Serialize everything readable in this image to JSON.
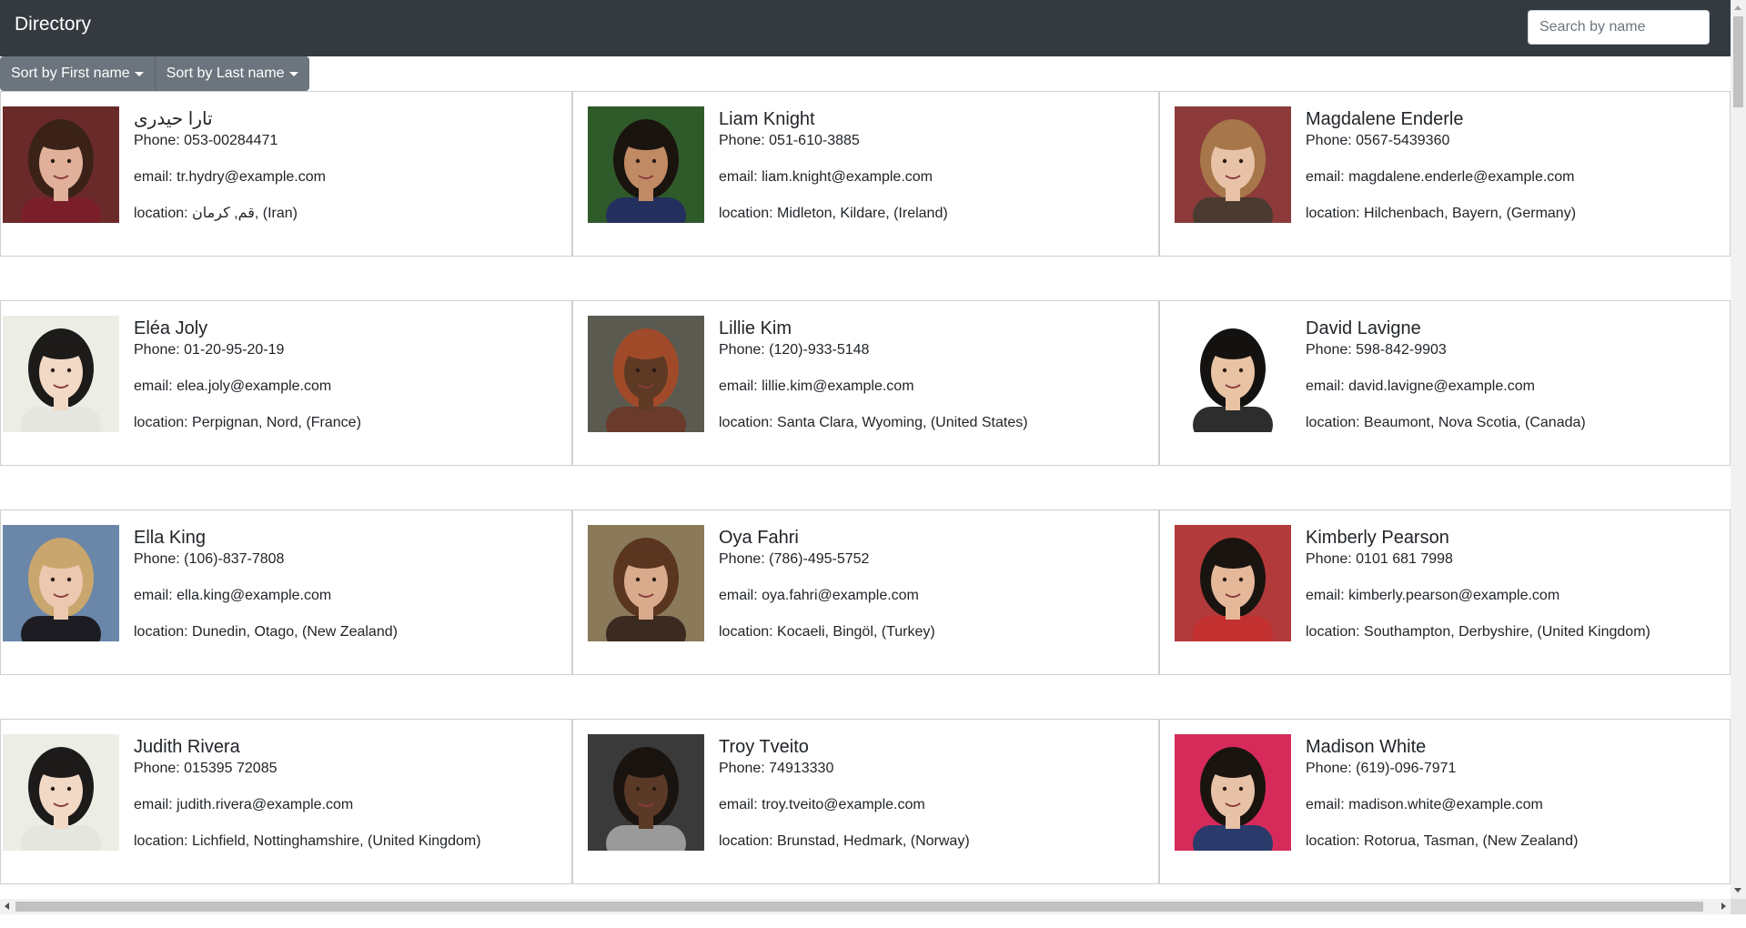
{
  "header": {
    "title": "Directory",
    "search_placeholder": "Search by name"
  },
  "sort": {
    "first_name_label": "Sort by First name",
    "last_name_label": "Sort by Last name"
  },
  "people": [
    {
      "name": "تارا حیدری",
      "phone": "Phone: 053-00284471",
      "email": "email: tr.hydry@example.com",
      "location": "location: قم, کرمان, (Iran)",
      "photo": {
        "bg": "#6b2a2a",
        "skin": "#e0b09a",
        "hair": "#3a2218",
        "shirt": "#7a1f2a"
      }
    },
    {
      "name": "Liam Knight",
      "phone": "Phone: 051-610-3885",
      "email": "email: liam.knight@example.com",
      "location": "location: Midleton, Kildare, (Ireland)",
      "photo": {
        "bg": "#2f5a2a",
        "skin": "#c08a64",
        "hair": "#1a140f",
        "shirt": "#23305e"
      }
    },
    {
      "name": "Magdalene Enderle",
      "phone": "Phone: 0567-5439360",
      "email": "email: magdalene.enderle@example.com",
      "location": "location: Hilchenbach, Bayern, (Germany)",
      "photo": {
        "bg": "#8c3a3a",
        "skin": "#e7c2a6",
        "hair": "#a7764a",
        "shirt": "#4a3a30"
      }
    },
    {
      "name": "Eléa Joly",
      "phone": "Phone: 01-20-95-20-19",
      "email": "email: elea.joly@example.com",
      "location": "location: Perpignan, Nord, (France)",
      "photo": {
        "bg": "#eceee6",
        "skin": "#f1d9c6",
        "hair": "#1d1a1a",
        "shirt": "#e6e6e0"
      }
    },
    {
      "name": "Lillie Kim",
      "phone": "Phone: (120)-933-5148",
      "email": "email: lillie.kim@example.com",
      "location": "location: Santa Clara, Wyoming, (United States)",
      "photo": {
        "bg": "#5a5a50",
        "skin": "#5e3a24",
        "hair": "#a04a2a",
        "shirt": "#6a3a2a"
      }
    },
    {
      "name": "David Lavigne",
      "phone": "Phone: 598-842-9903",
      "email": "email: david.lavigne@example.com",
      "location": "location: Beaumont, Nova Scotia, (Canada)",
      "photo": {
        "bg": "#ffffff",
        "skin": "#e8c3a4",
        "hair": "#141210",
        "shirt": "#2d2d2d"
      }
    },
    {
      "name": "Ella King",
      "phone": "Phone: (106)-837-7808",
      "email": "email: ella.king@example.com",
      "location": "location: Dunedin, Otago, (New Zealand)",
      "photo": {
        "bg": "#6a86a8",
        "skin": "#ecc8b0",
        "hair": "#c9a66e",
        "shirt": "#1c1c22"
      }
    },
    {
      "name": "Oya Fahri",
      "phone": "Phone: (786)-495-5752",
      "email": "email: oya.fahri@example.com",
      "location": "location: Kocaeli, Bingöl, (Turkey)",
      "photo": {
        "bg": "#8a7a5a",
        "skin": "#d9ab8c",
        "hair": "#5a3520",
        "shirt": "#3a2a20"
      }
    },
    {
      "name": "Kimberly Pearson",
      "phone": "Phone: 0101 681 7998",
      "email": "email: kimberly.pearson@example.com",
      "location": "location: Southampton, Derbyshire, (United Kingdom)",
      "photo": {
        "bg": "#b33a3a",
        "skin": "#e6b89a",
        "hair": "#1a1410",
        "shirt": "#c23030"
      }
    },
    {
      "name": "Judith Rivera",
      "phone": "Phone: 015395 72085",
      "email": "email: judith.rivera@example.com",
      "location": "location: Lichfield, Nottinghamshire, (United Kingdom)",
      "photo": {
        "bg": "#eceee6",
        "skin": "#f1d9c6",
        "hair": "#1d1a1a",
        "shirt": "#e6e6e0"
      }
    },
    {
      "name": "Troy Tveito",
      "phone": "Phone: 74913330",
      "email": "email: troy.tveito@example.com",
      "location": "location: Brunstad, Hedmark, (Norway)",
      "photo": {
        "bg": "#3a3a3a",
        "skin": "#5a3a26",
        "hair": "#1a1410",
        "shirt": "#9a9a9a"
      }
    },
    {
      "name": "Madison White",
      "phone": "Phone: (619)-096-7971",
      "email": "email: madison.white@example.com",
      "location": "location: Rotorua, Tasman, (New Zealand)",
      "photo": {
        "bg": "#d62a5a",
        "skin": "#e8c2a6",
        "hair": "#1a1410",
        "shirt": "#2a3a6a"
      }
    }
  ]
}
